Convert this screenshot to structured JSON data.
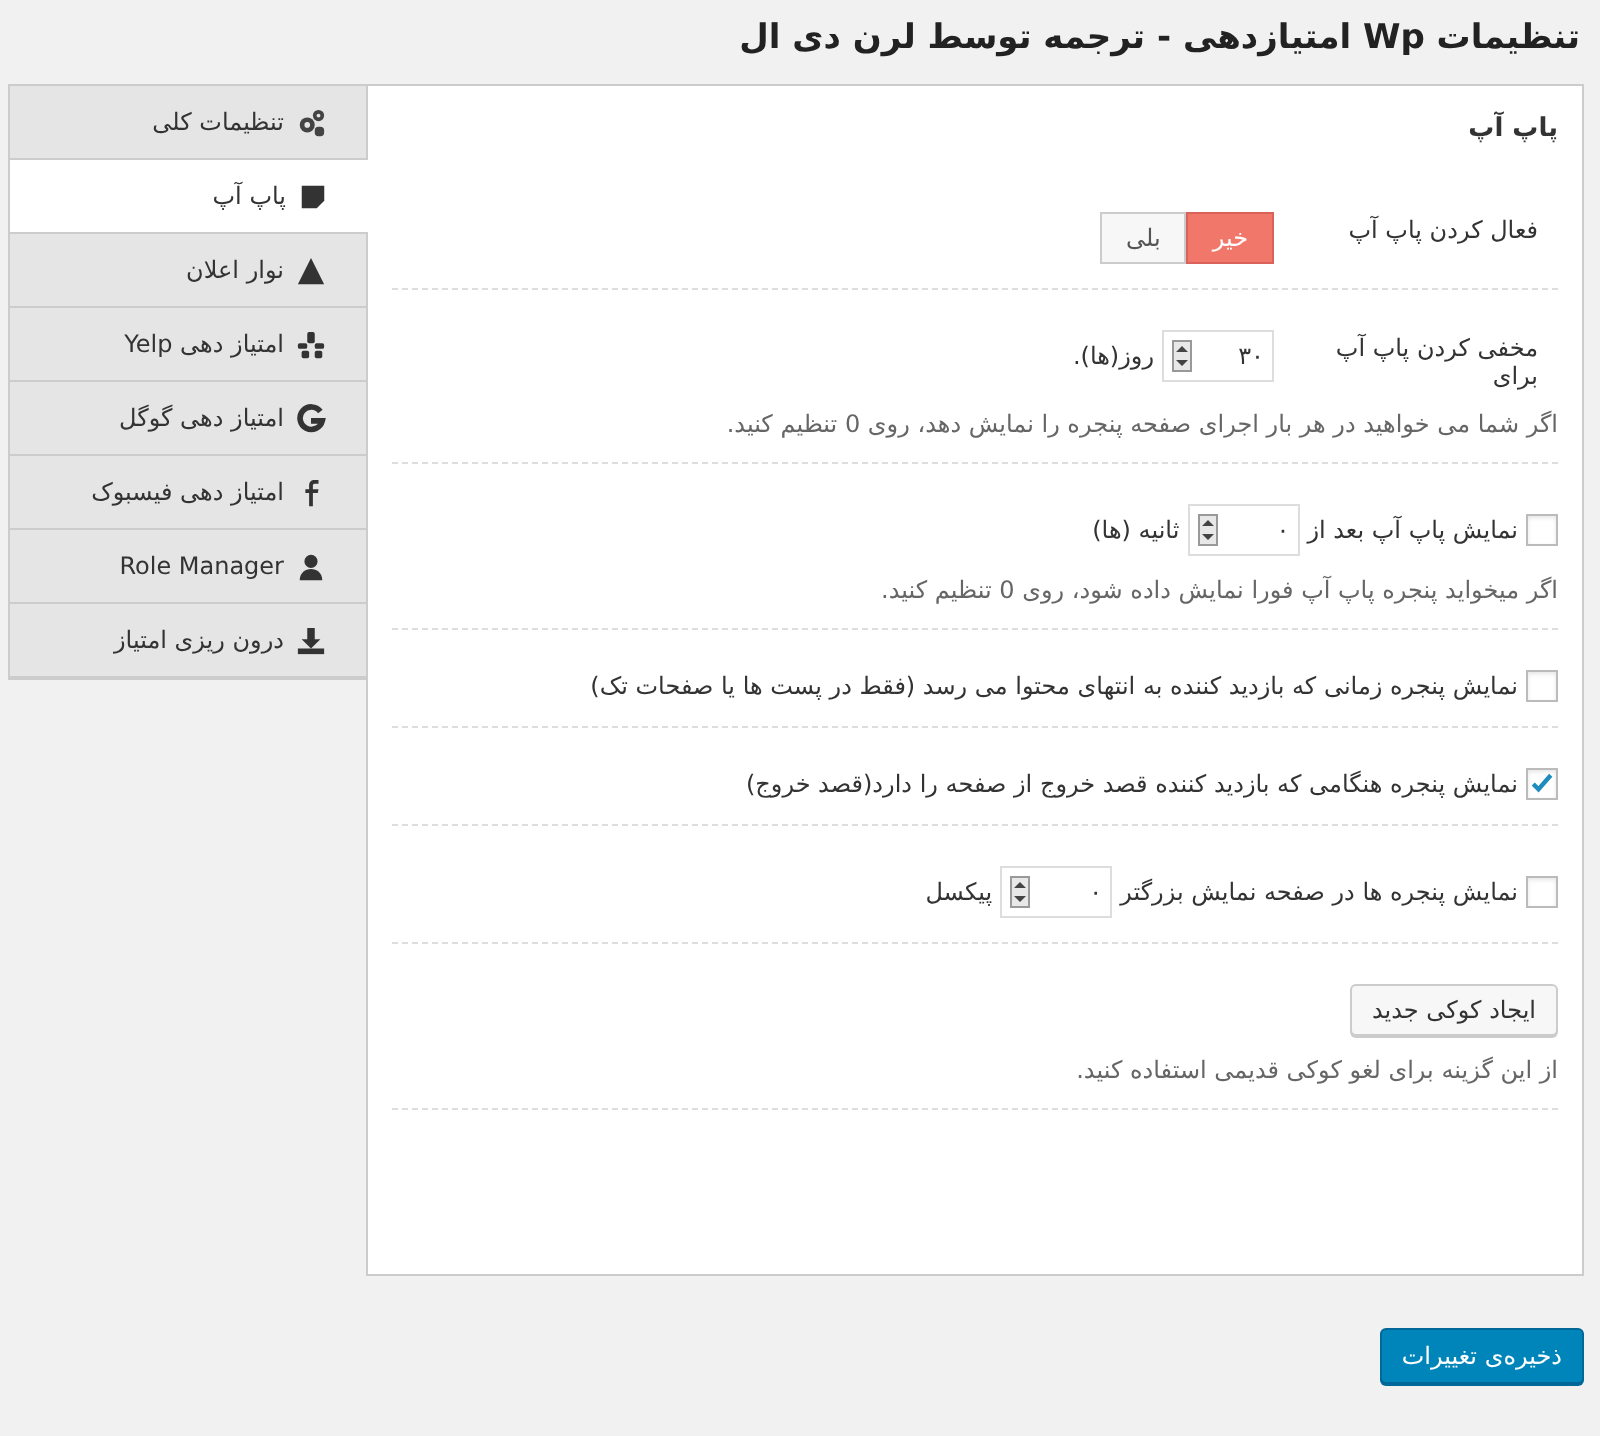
{
  "page_title": "تنظیمات Wp امتیازدهی - ترجمه توسط لرن دی ال",
  "sidebar": {
    "items": [
      {
        "label": "تنظیمات کلی",
        "selected": false
      },
      {
        "label": "پاپ آپ",
        "selected": true
      },
      {
        "label": "نوار اعلان",
        "selected": false
      },
      {
        "label": "امتیاز دهی Yelp",
        "selected": false
      },
      {
        "label": "امتیاز دهی گوگل",
        "selected": false
      },
      {
        "label": "امتیاز دهی فیسبوک",
        "selected": false
      },
      {
        "label": "Role Manager",
        "selected": false
      },
      {
        "label": "درون ریزی امتیاز",
        "selected": false
      }
    ]
  },
  "panel": {
    "title": "پاپ آپ",
    "rows": [
      {
        "kind": "toggle",
        "label": "فعال کردن پاپ آپ",
        "options": [
          {
            "label": "خیر",
            "selected": true
          },
          {
            "label": "بلی",
            "selected": false
          }
        ]
      },
      {
        "kind": "number",
        "label": "مخفی کردن پاپ آپ برای",
        "value": "۳۰",
        "suffix": "روز(ها).",
        "description": "اگر شما می خواهید در هر بار اجرای صفحه پنجره را نمایش دهد، روی 0 تنظیم کنید."
      },
      {
        "kind": "checkbox",
        "checked": false,
        "label": "نمایش پاپ آپ بعد از",
        "value": "۰",
        "suffix": "ثانیه (ها)",
        "description": "اگر میخواید پنجره پاپ آپ فورا نمایش داده شود، روی 0 تنظیم کنید."
      },
      {
        "kind": "checkbox",
        "checked": false,
        "label": "نمایش پنجره زمانی که بازدید کننده به انتهای محتوا می رسد (فقط در پست ها یا صفحات تک)"
      },
      {
        "kind": "checkbox",
        "checked": true,
        "label": "نمایش پنجره هنگامی که بازدید کننده قصد خروج از صفحه را دارد(قصد خروج)"
      },
      {
        "kind": "checkbox",
        "checked": false,
        "label": "نمایش پنجره ها در صفحه نمایش بزرگتر",
        "value": "۰",
        "suffix": "پیکسل"
      },
      {
        "kind": "button",
        "label": "ایجاد کوکی جدید",
        "description": "از این گزینه برای لغو کوکی قدیمی استفاده کنید."
      }
    ]
  },
  "save_button": "ذخیره‌ی تغییرات"
}
